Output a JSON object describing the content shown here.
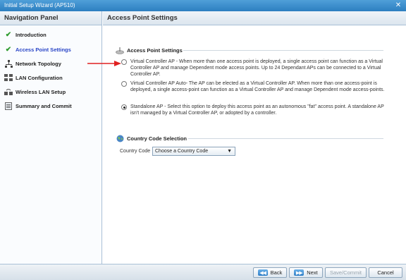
{
  "window": {
    "title": "Initial Setup Wizard (AP510)"
  },
  "nav": {
    "header": "Navigation Panel",
    "items": [
      {
        "label": "Introduction",
        "icon": "check-icon"
      },
      {
        "label": "Access Point Settings",
        "icon": "check-icon",
        "active": true
      },
      {
        "label": "Network Topology",
        "icon": "topology-icon"
      },
      {
        "label": "LAN Configuration",
        "icon": "lan-icon"
      },
      {
        "label": "Wireless LAN Setup",
        "icon": "wireless-icon"
      },
      {
        "label": "Summary and Commit",
        "icon": "summary-icon"
      }
    ]
  },
  "main": {
    "header": "Access Point Settings",
    "ap_section": {
      "title": "Access Point Settings",
      "options": [
        {
          "text": "Virtual Controller AP - When more than one access point is deployed, a single access point can function as a Virtual Controller AP and manage Dependent mode access points. Up to 24 Dependant APs can be connected to a Virtual Controller AP.",
          "selected": false
        },
        {
          "text": "Virtual Controller AP Auto- The AP can be elected as a Virtual Controller AP.  When more than one access-point is deployed, a single access-point can function as a Virtual Controller AP and manage Dependent mode access-points.",
          "selected": false
        },
        {
          "text": "Standalone AP - Select this option to deploy this access point as an autonomous \"fat\" access point. A standalone AP isn't managed by a Virtual Controller AP, or adopted by a controller.",
          "selected": true
        }
      ]
    },
    "country_section": {
      "title": "Country Code Selection",
      "label": "Country Code",
      "select_value": "Choose a Country Code"
    }
  },
  "footer": {
    "back": "Back",
    "next": "Next",
    "save": "Save/Commit",
    "cancel": "Cancel"
  },
  "colors": {
    "active_nav": "#2945c7",
    "arrow": "#e02020",
    "check": "#2e9b2e"
  }
}
